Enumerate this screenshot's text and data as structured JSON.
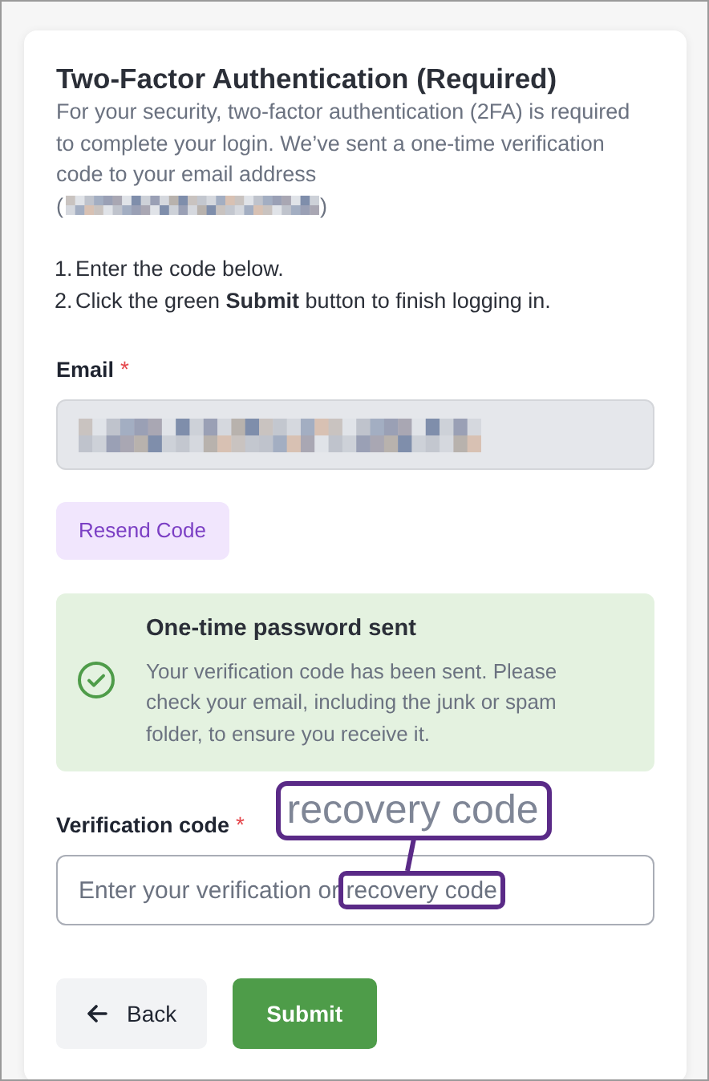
{
  "title": "Two-Factor Authentication (Required)",
  "intro": "For your security, two-factor authentication (2FA) is required to complete your login. We’ve sent a one-time verification code to your email address",
  "email_open": "(",
  "email_close": ")",
  "steps": [
    {
      "number": "1.",
      "text": "Enter the code below."
    },
    {
      "number": "2.",
      "text": "Click the green **Submit** button to finish logging in."
    }
  ],
  "email": {
    "label": "Email",
    "required": true,
    "required_mark": "*",
    "disabled": true
  },
  "resend_button": "Resend Code",
  "alert": {
    "kind": "success",
    "title": "One-time password sent",
    "text": "Your verification code has been sent. Please check your email, including the junk or spam folder, to ensure you receive it."
  },
  "verification": {
    "label": "Verification code",
    "required": true,
    "required_mark": "*",
    "placeholder": "Enter your verification or recovery code"
  },
  "annotation": {
    "magnified_text": "recovery code"
  },
  "buttons": [
    {
      "kind": "back",
      "label": "Back"
    },
    {
      "kind": "submit",
      "label": "Submit"
    }
  ]
}
